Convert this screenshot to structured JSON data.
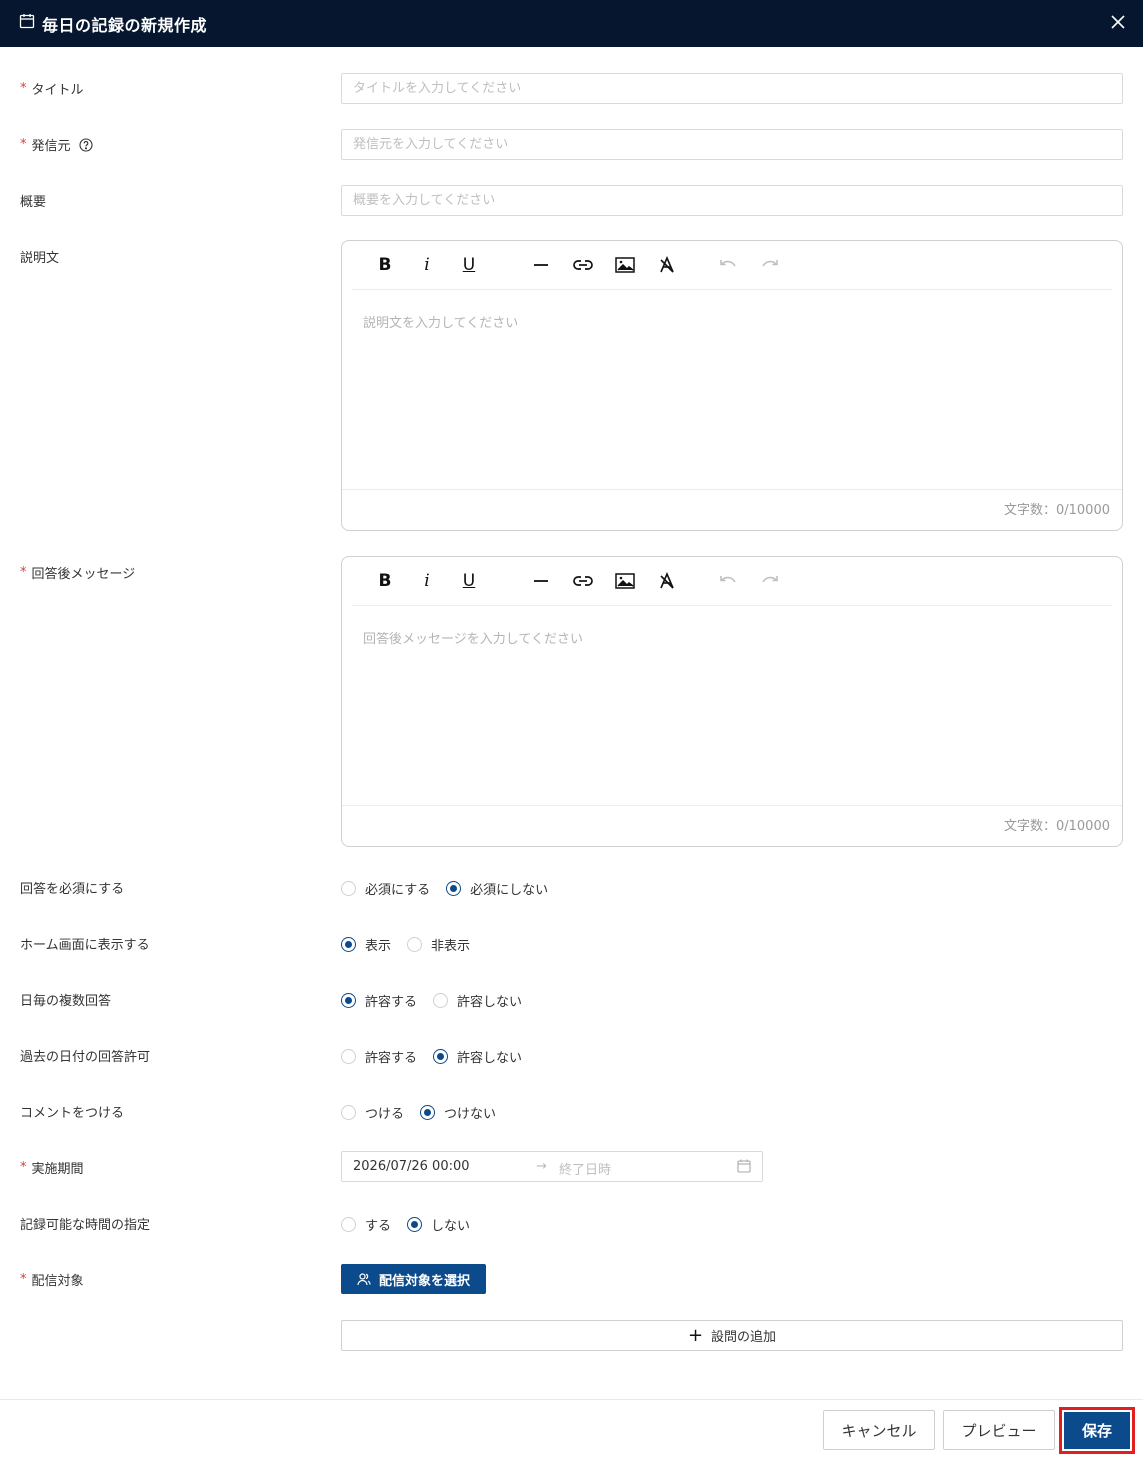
{
  "header": {
    "title": "毎日の記録の新規作成"
  },
  "fields": {
    "title": {
      "label": "タイトル",
      "placeholder": "タイトルを入力してください"
    },
    "sender": {
      "label": "発信元",
      "placeholder": "発信元を入力してください"
    },
    "summary": {
      "label": "概要",
      "placeholder": "概要を入力してください"
    },
    "description": {
      "label": "説明文",
      "placeholder": "説明文を入力してください",
      "count": "文字数：0/10000"
    },
    "after_message": {
      "label": "回答後メッセージ",
      "placeholder": "回答後メッセージを入力してください",
      "count": "文字数：0/10000"
    }
  },
  "toolbar": {
    "bold": "B",
    "italic": "i",
    "underline": "U"
  },
  "radios": {
    "required": {
      "label": "回答を必須にする",
      "options": [
        "必須にする",
        "必須にしない"
      ],
      "selected": 1
    },
    "home": {
      "label": "ホーム画面に表示する",
      "options": [
        "表示",
        "非表示"
      ],
      "selected": 0
    },
    "daily_multi": {
      "label": "日毎の複数回答",
      "options": [
        "許容する",
        "許容しない"
      ],
      "selected": 0
    },
    "past_date": {
      "label": "過去の日付の回答許可",
      "options": [
        "許容する",
        "許容しない"
      ],
      "selected": 1
    },
    "comment": {
      "label": "コメントをつける",
      "options": [
        "つける",
        "つけない"
      ],
      "selected": 1
    },
    "time_spec": {
      "label": "記録可能な時間の指定",
      "options": [
        "する",
        "しない"
      ],
      "selected": 1
    }
  },
  "period": {
    "label": "実施期間",
    "start": "2026/07/26 00:00",
    "arrow": "→",
    "end_placeholder": "終了日時"
  },
  "target": {
    "label": "配信対象",
    "button": "配信対象を選択"
  },
  "add_question": {
    "plus": "+",
    "label": "設問の追加"
  },
  "footer": {
    "cancel": "キャンセル",
    "preview": "プレビュー",
    "save": "保存"
  },
  "colors": {
    "header_bg": "#05162e",
    "primary": "#0b4a8b",
    "required": "#e53935",
    "highlight": "#e02020"
  }
}
